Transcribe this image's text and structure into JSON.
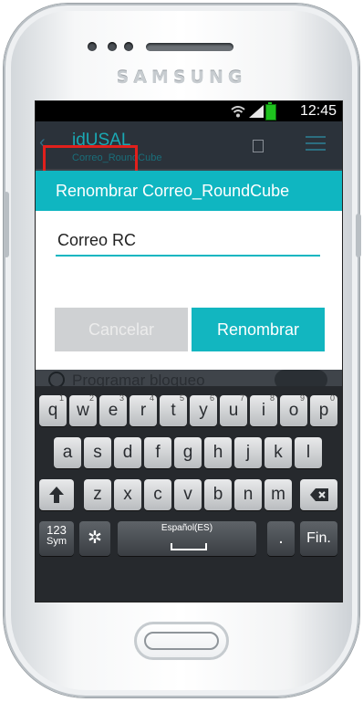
{
  "device": {
    "brand": "SAMSUNG"
  },
  "status_bar": {
    "time": "12:45"
  },
  "app_bar": {
    "title": "idUSAL",
    "subtitle": "Correo_RoundCube"
  },
  "dialog": {
    "title": "Renombrar Correo_RoundCube",
    "input_value": "Correo RC",
    "cancel_label": "Cancelar",
    "confirm_label": "Renombrar"
  },
  "background_settings": {
    "item_label": "Programar bloqueo"
  },
  "keyboard": {
    "row1": [
      {
        "key": "q",
        "sup": "1"
      },
      {
        "key": "w",
        "sup": "2"
      },
      {
        "key": "e",
        "sup": "3"
      },
      {
        "key": "r",
        "sup": "4"
      },
      {
        "key": "t",
        "sup": "5"
      },
      {
        "key": "y",
        "sup": "6"
      },
      {
        "key": "u",
        "sup": "7"
      },
      {
        "key": "i",
        "sup": "8"
      },
      {
        "key": "o",
        "sup": "9"
      },
      {
        "key": "p",
        "sup": "0"
      }
    ],
    "row2": [
      "a",
      "s",
      "d",
      "f",
      "g",
      "h",
      "j",
      "k",
      "l"
    ],
    "row3": [
      "z",
      "x",
      "c",
      "v",
      "b",
      "n",
      "m"
    ],
    "sym_label": "123",
    "sym_sub": "Sym",
    "space_label": "Español(ES)",
    "period_label": ".",
    "enter_label": "Fin.",
    "colors": {
      "accent": "#0fb6c1",
      "highlight": "#e0201c"
    }
  }
}
